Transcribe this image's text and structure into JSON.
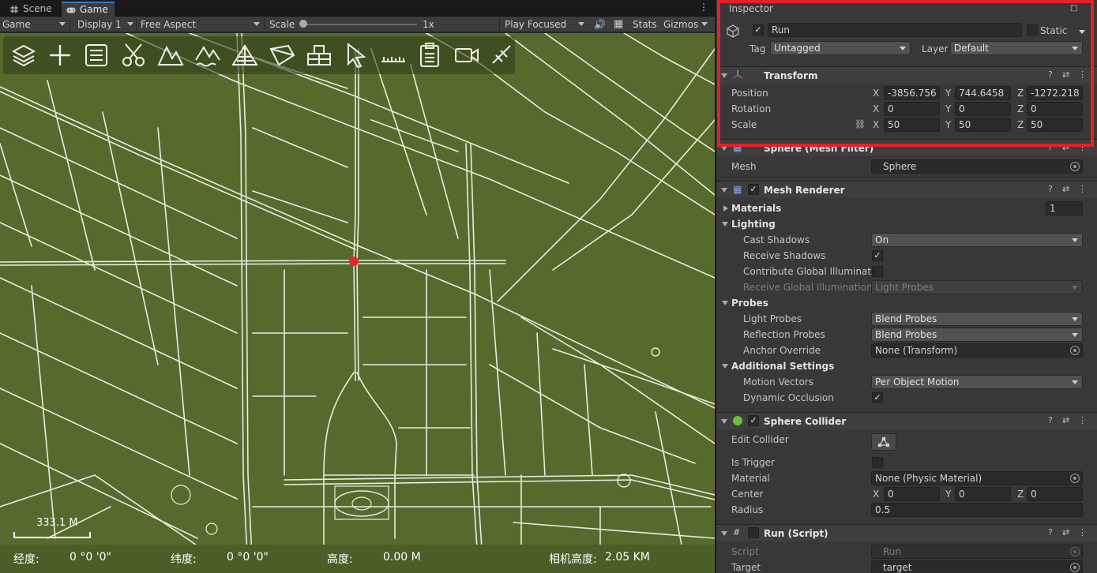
{
  "tabs": [
    {
      "label": "Scene",
      "icon": "scene-hash-icon"
    },
    {
      "label": "Game",
      "icon": "gamepad-icon"
    }
  ],
  "gamebar": {
    "mode": "Game",
    "display": "Display 1",
    "aspect": "Free Aspect",
    "scale_label": "Scale",
    "scale_value": "1x",
    "play_mode": "Play Focused",
    "stats": "Stats",
    "gizmos": "Gizmos"
  },
  "map_tools": [
    "layers-icon",
    "add-icon",
    "list-icon",
    "scissors-icon",
    "terrain-icon",
    "terrain-water-icon",
    "terrain-mesh-icon",
    "shape-icon",
    "building-icon",
    "cursor-icon",
    "ruler-icon",
    "clipboard-icon",
    "video-camera-icon",
    "measure-icon"
  ],
  "map": {
    "scale_text": "333.1  M",
    "status": {
      "lon_label": "经度:",
      "lon_value": "0 °0 '0\"",
      "lat_label": "纬度:",
      "lat_value": "0 °0 '0\"",
      "alt_label": "高度:",
      "alt_value": "0.00 M",
      "cam_label": "相机高度:",
      "cam_value": "2.05  KM"
    }
  },
  "inspector": {
    "title": "Inspector",
    "object_name": "Run",
    "static_label": "Static",
    "tag_label": "Tag",
    "tag_value": "Untagged",
    "layer_label": "Layer",
    "layer_value": "Default",
    "transform": {
      "title": "Transform",
      "position_label": "Position",
      "rotation_label": "Rotation",
      "scale_label": "Scale",
      "position": {
        "x": "-3856.756",
        "y": "744.6458",
        "z": "-1272.218"
      },
      "rotation": {
        "x": "0",
        "y": "0",
        "z": "0"
      },
      "scale": {
        "x": "50",
        "y": "50",
        "z": "50"
      }
    },
    "mesh_filter": {
      "title": "Sphere (Mesh Filter)",
      "mesh_label": "Mesh",
      "mesh_value": "Sphere"
    },
    "mesh_renderer": {
      "title": "Mesh Renderer",
      "materials_label": "Materials",
      "materials_count": "1",
      "lighting_label": "Lighting",
      "cast_shadows_label": "Cast Shadows",
      "cast_shadows_value": "On",
      "receive_shadows_label": "Receive Shadows",
      "contribute_gi_label": "Contribute Global Illumination",
      "receive_gi_label": "Receive Global Illumination",
      "receive_gi_value": "Light Probes",
      "probes_label": "Probes",
      "light_probes_label": "Light Probes",
      "light_probes_value": "Blend Probes",
      "reflection_probes_label": "Reflection Probes",
      "reflection_probes_value": "Blend Probes",
      "anchor_override_label": "Anchor Override",
      "anchor_override_value": "None (Transform)",
      "additional_label": "Additional Settings",
      "motion_vectors_label": "Motion Vectors",
      "motion_vectors_value": "Per Object Motion",
      "dynamic_occlusion_label": "Dynamic Occlusion"
    },
    "sphere_collider": {
      "title": "Sphere Collider",
      "edit_collider_label": "Edit Collider",
      "is_trigger_label": "Is Trigger",
      "material_label": "Material",
      "material_value": "None (Physic Material)",
      "center_label": "Center",
      "center": {
        "x": "0",
        "y": "0",
        "z": "0"
      },
      "radius_label": "Radius",
      "radius_value": "0.5"
    },
    "run_script": {
      "title": "Run (Script)",
      "script_label": "Script",
      "script_value": "Run",
      "target_label": "Target",
      "target_value": "target"
    }
  },
  "colors": {
    "highlight": "#e5202a",
    "map_bg": "#566a2e",
    "marker": "#e8242c"
  }
}
